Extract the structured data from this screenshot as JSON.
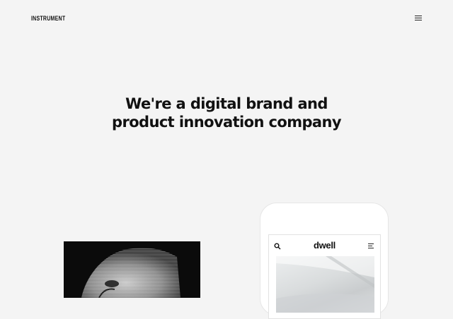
{
  "header": {
    "logo_text": "INSTRUMENT",
    "menu_icon": "hamburger-menu-icon"
  },
  "hero": {
    "headline_line1": "We're a digital brand and",
    "headline_line2": "product innovation company"
  },
  "showcase": {
    "left_card": {
      "image": "dark-halftone-portrait"
    },
    "phone": {
      "app_logo": "dwell",
      "search_icon": "search-icon",
      "menu_icon": "menu-icon",
      "image": "architecture-photo"
    }
  },
  "colors": {
    "background": "#f4f4f4",
    "text": "#111111",
    "phone_frame": "#ffffff",
    "dark_card": "#0b0b0b"
  }
}
